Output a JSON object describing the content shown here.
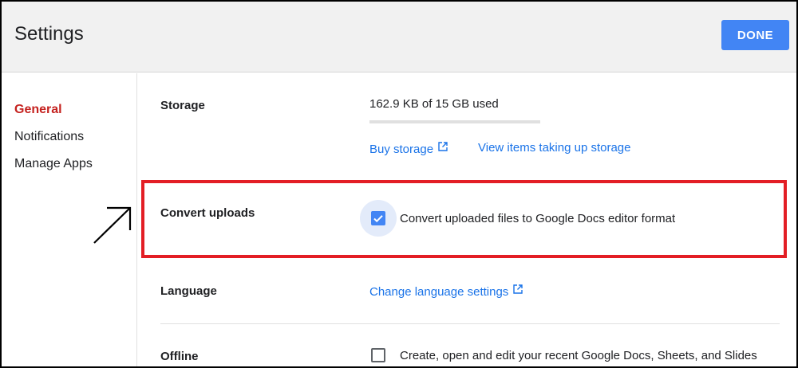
{
  "header": {
    "title": "Settings",
    "done_label": "DONE"
  },
  "sidebar": {
    "items": [
      {
        "label": "General",
        "active": true
      },
      {
        "label": "Notifications",
        "active": false
      },
      {
        "label": "Manage Apps",
        "active": false
      }
    ]
  },
  "storage": {
    "label": "Storage",
    "usage": "162.9 KB of 15 GB used",
    "usage_fraction": 1e-05,
    "buy_link": "Buy storage",
    "view_link": "View items taking up storage"
  },
  "convert": {
    "label": "Convert uploads",
    "checkbox_label": "Convert uploaded files to Google Docs editor format",
    "checked": true
  },
  "language": {
    "label": "Language",
    "link": "Change language settings"
  },
  "offline": {
    "label": "Offline",
    "checkbox_label": "Create, open and edit your recent Google Docs, Sheets, and Slides",
    "checked": false
  },
  "colors": {
    "accent": "#4285f4",
    "link": "#1a73e8",
    "active_nav": "#c5221f",
    "highlight_border": "#e31e25"
  },
  "icons": [
    "external-link-icon",
    "check-icon",
    "arrow-annotation-icon"
  ]
}
